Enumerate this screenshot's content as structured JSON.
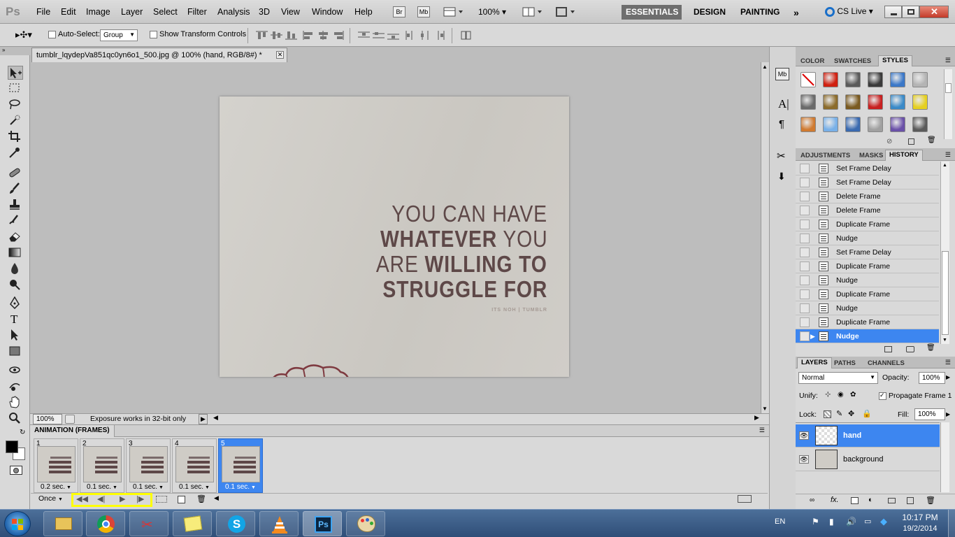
{
  "app": {
    "logo": "Ps"
  },
  "menu": [
    "File",
    "Edit",
    "Image",
    "Layer",
    "Select",
    "Filter",
    "Analysis",
    "3D",
    "View",
    "Window",
    "Help"
  ],
  "appbar": {
    "bridge": "Br",
    "minibridge": "Mb",
    "zoom": "100%"
  },
  "workspaces": {
    "active": "ESSENTIALS",
    "items": [
      "DESIGN",
      "PAINTING"
    ],
    "cslive": "CS Live"
  },
  "options": {
    "auto_select_label": "Auto-Select:",
    "auto_select_value": "Group",
    "transform_label": "Show Transform Controls"
  },
  "document": {
    "tab_title": "tumblr_lqydepVa851qc0yn6o1_500.jpg @ 100% (hand, RGB/8#) *",
    "quote_lines": [
      "YOU CAN HAVE",
      "WHATEVER YOU",
      "ARE WILLING TO",
      "STRUGGLE FOR"
    ],
    "quote_bold": [
      "WHATEVER",
      "WILLING TO",
      "STRUGGLE FOR"
    ],
    "credit": "ITS NOH | TUMBLR"
  },
  "status": {
    "zoom": "100%",
    "message": "Exposure works in 32-bit only"
  },
  "animation": {
    "title": "ANIMATION (FRAMES)",
    "loop": "Once",
    "frames": [
      {
        "num": "1",
        "delay": "0.2 sec."
      },
      {
        "num": "2",
        "delay": "0.1 sec."
      },
      {
        "num": "3",
        "delay": "0.1 sec."
      },
      {
        "num": "4",
        "delay": "0.1 sec."
      },
      {
        "num": "5",
        "delay": "0.1 sec."
      }
    ],
    "selected_frame": "5",
    "highlight_color": "#ffff00"
  },
  "styles_panel": {
    "tabs": [
      "COLOR",
      "SWATCHES",
      "STYLES"
    ],
    "active": "STYLES"
  },
  "history_panel": {
    "tabs": [
      "ADJUSTMENTS",
      "MASKS",
      "HISTORY"
    ],
    "active": "HISTORY",
    "items": [
      "Set Frame Delay",
      "Set Frame Delay",
      "Delete Frame",
      "Delete Frame",
      "Duplicate Frame",
      "Nudge",
      "Set Frame Delay",
      "Duplicate Frame",
      "Nudge",
      "Duplicate Frame",
      "Nudge",
      "Duplicate Frame",
      "Nudge"
    ],
    "selected": "Nudge"
  },
  "layers_panel": {
    "tabs": [
      "LAYERS",
      "PATHS",
      "CHANNELS"
    ],
    "active": "LAYERS",
    "blend_mode": "Normal",
    "opacity_label": "Opacity:",
    "opacity": "100%",
    "unify_label": "Unify:",
    "propagate_label": "Propagate Frame 1",
    "lock_label": "Lock:",
    "fill_label": "Fill:",
    "fill": "100%",
    "layers": [
      {
        "name": "hand",
        "selected": true
      },
      {
        "name": "background",
        "selected": false
      }
    ]
  },
  "taskbar": {
    "lang": "EN",
    "time": "10:17 PM",
    "date": "19/2/2014"
  },
  "colors": {
    "selection": "#3d86f0",
    "panel": "#d9d9d9",
    "canvas_bg": "#bdbdbd",
    "quote_text": "#5e4848"
  }
}
